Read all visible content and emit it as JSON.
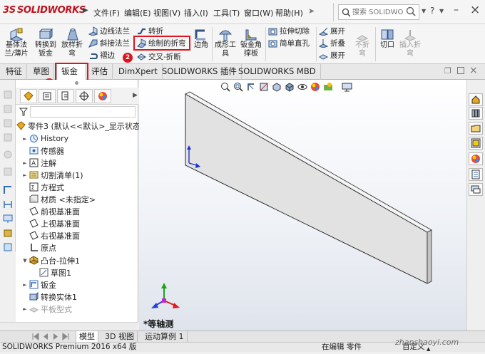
{
  "app": {
    "logo_ds": "3S",
    "logo_text": "SOLIDWORKS",
    "watermark": "zhanshaoyi.com"
  },
  "menu": {
    "items": [
      "文件(F)",
      "编辑(E)",
      "视图(V)",
      "插入(I)",
      "工具(T)",
      "窗口(W)",
      "帮助(H)"
    ]
  },
  "search": {
    "placeholder": "搜索 SOLIDWO"
  },
  "titlebar": {
    "help": "?",
    "min": "–",
    "close": "×"
  },
  "ribbon": {
    "base_flange": [
      "基体法",
      "兰/薄片"
    ],
    "convert_sheet": [
      "转换到",
      "钣金"
    ],
    "lofted_bend": [
      "放样折",
      "弯"
    ],
    "edge_flange": "边线法兰",
    "miter_flange": "斜接法兰",
    "hem": "褶边",
    "jog": "转折",
    "sketched_bend": "绘制的折弯",
    "cross_break": "交叉-折断",
    "corners": "边角",
    "forming_tool": [
      "成形工",
      "具"
    ],
    "gusset": [
      "钣金角",
      "撑板"
    ],
    "extruded_cut": "拉伸切除",
    "simple_hole": "简单直孔",
    "unfold": "展开",
    "fold": "折叠",
    "flatten": "展开",
    "no_bends": [
      "不折",
      "弯"
    ],
    "rip": "切口",
    "insert_bends": [
      "插入折",
      "弯"
    ]
  },
  "tabs": [
    "特征",
    "草图",
    "钣金",
    "评估",
    "DimXpert",
    "SOLIDWORKS 插件",
    "SOLIDWORKS MBD"
  ],
  "badges": [
    "1",
    "2"
  ],
  "tree": {
    "root": "零件3 (默认<<默认>_显示状态",
    "items": [
      "History",
      "传感器",
      "注解",
      "切割清单(1)",
      "方程式",
      "材质 <未指定>",
      "前视基准面",
      "上视基准面",
      "右视基准面",
      "原点",
      "凸台-拉伸1",
      "草图1",
      "钣金",
      "转换实体1",
      "平板型式"
    ]
  },
  "viewport": {
    "view_label": "*等轴测"
  },
  "bottom_tabs": [
    "模型",
    "3D 视图",
    "运动算例 1"
  ],
  "status": {
    "left": "SOLIDWORKS Premium 2016 x64 版",
    "editing": "在编辑 零件",
    "custom": "自定义"
  },
  "colors": {
    "accent_red": "#e0141e",
    "brand_red": "#c0131f",
    "part_face": "#e2e2e2",
    "axis_blue": "#2233cc"
  }
}
